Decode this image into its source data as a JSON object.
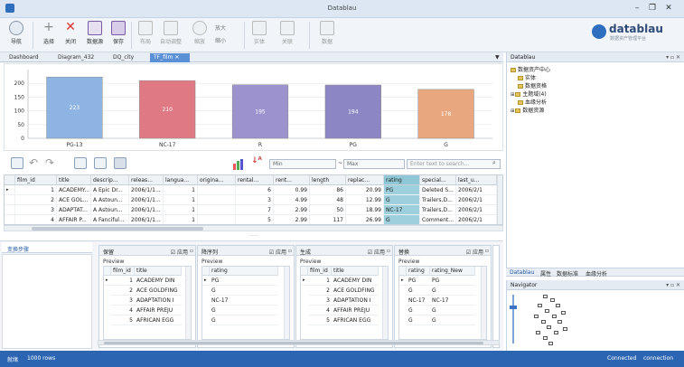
{
  "window": {
    "title": "Datablau"
  },
  "ribbon": {
    "buttons": [
      {
        "name": "nav",
        "label": "导航"
      },
      {
        "name": "select",
        "label": "选择"
      },
      {
        "name": "close",
        "label": "关闭"
      },
      {
        "name": "datasource",
        "label": "数据源"
      },
      {
        "name": "save",
        "label": "保存"
      },
      {
        "name": "layout",
        "label": "布局"
      },
      {
        "name": "auto-layout",
        "label": "自动调整"
      },
      {
        "name": "zoom",
        "label": "缩放"
      },
      {
        "name": "entity",
        "label": "实体"
      },
      {
        "name": "relation",
        "label": "关联"
      },
      {
        "name": "data",
        "label": "数据"
      }
    ],
    "zoom_in": "放大",
    "zoom_out": "缩小"
  },
  "logo": {
    "name": "datablau",
    "tagline": "数据资产管理平台"
  },
  "tabs": [
    "Dashboard",
    "Diagram_432",
    "DQ_city",
    "TF_film"
  ],
  "active_tab": "TF_film",
  "chart_data": {
    "type": "bar",
    "categories": [
      "PG-13",
      "NC-17",
      "R",
      "PG",
      "G"
    ],
    "values": [
      223,
      210,
      195,
      194,
      178
    ],
    "ylim": [
      0,
      250
    ],
    "yticks": [
      0,
      50,
      100,
      150,
      200
    ],
    "colors": [
      "#8eb4e3",
      "#df7a84",
      "#9b92ce",
      "#8d86c4",
      "#e8a77f"
    ],
    "grid": true,
    "legend": "none"
  },
  "filters": {
    "min_label": "Min",
    "max_label": "Max",
    "search_placeholder": "Enter text to search..."
  },
  "grid": {
    "columns": [
      "film_id",
      "title",
      "descrip...",
      "releas...",
      "langua...",
      "origina...",
      "rental...",
      "rent...",
      "length",
      "replac...",
      "rating",
      "special...",
      "last_u..."
    ],
    "rows": [
      [
        "1",
        "ACADEMY...",
        "A Epic Dr...",
        "2006/1/1...",
        "1",
        "",
        "6",
        "0.99",
        "86",
        "20.99",
        "PG",
        "Deleted S...",
        "2006/2/1"
      ],
      [
        "2",
        "ACE GOL...",
        "A Astoun...",
        "2006/1/1...",
        "1",
        "",
        "3",
        "4.99",
        "48",
        "12.99",
        "G",
        "Trailers,D...",
        "2006/2/1"
      ],
      [
        "3",
        "ADAPTAT...",
        "A Astoun...",
        "2006/1/1...",
        "1",
        "",
        "7",
        "2.99",
        "50",
        "18.99",
        "NC-17",
        "Trailers,D...",
        "2006/2/1"
      ],
      [
        "4",
        "AFFAIR P...",
        "A Fanciful...",
        "2006/1/1...",
        "1",
        "",
        "5",
        "2.99",
        "117",
        "26.99",
        "G",
        "Comment...",
        "2006/2/1"
      ]
    ]
  },
  "steps": {
    "title": "变换步骤"
  },
  "transforms": [
    {
      "title": "保留",
      "apply": "应用",
      "preview": "Preview",
      "columns": [
        "film_id",
        "title"
      ],
      "rows": [
        [
          "1",
          "ACADEMY DIN"
        ],
        [
          "2",
          "ACE GOLDFING"
        ],
        [
          "3",
          "ADAPTATION I"
        ],
        [
          "4",
          "AFFAIR PREJU"
        ],
        [
          "5",
          "AFRICAN EGG"
        ]
      ]
    },
    {
      "title": "降序列",
      "apply": "应用",
      "preview": "Preview",
      "columns": [
        "rating"
      ],
      "rows": [
        [
          "PG"
        ],
        [
          "G"
        ],
        [
          "NC-17"
        ],
        [
          "G"
        ],
        [
          "G"
        ]
      ]
    },
    {
      "title": "生成",
      "apply": "应用",
      "preview": "Preview",
      "columns": [
        "film_id",
        "title"
      ],
      "rows": [
        [
          "1",
          "ACADEMY DIN"
        ],
        [
          "2",
          "ACE GOLDFING"
        ],
        [
          "3",
          "ADAPTATION I"
        ],
        [
          "4",
          "AFFAIR PREJU"
        ],
        [
          "5",
          "AFRICAN EGG"
        ]
      ]
    },
    {
      "title": "替换",
      "apply": "应用",
      "preview": "Preview",
      "columns": [
        "rating",
        "rating_New"
      ],
      "rows": [
        [
          "PG",
          "PG"
        ],
        [
          "G",
          "G"
        ],
        [
          "NC-17",
          "NC-17"
        ],
        [
          "G",
          "G"
        ],
        [
          "G",
          "G"
        ]
      ]
    }
  ],
  "right_panel": {
    "title": "Datablau",
    "tree": [
      "数据资产中心",
      "实体",
      "数据资格",
      "主题域(4)",
      "血缘分析",
      "数据资源"
    ]
  },
  "right_tabs": [
    "Datablau",
    "属性",
    "数据标准",
    "血缘分析"
  ],
  "navigator": {
    "title": "Navigator"
  },
  "status": {
    "left_label": "就绪",
    "rows": "1000 rows",
    "right1": "Connected",
    "right2": "connection"
  }
}
